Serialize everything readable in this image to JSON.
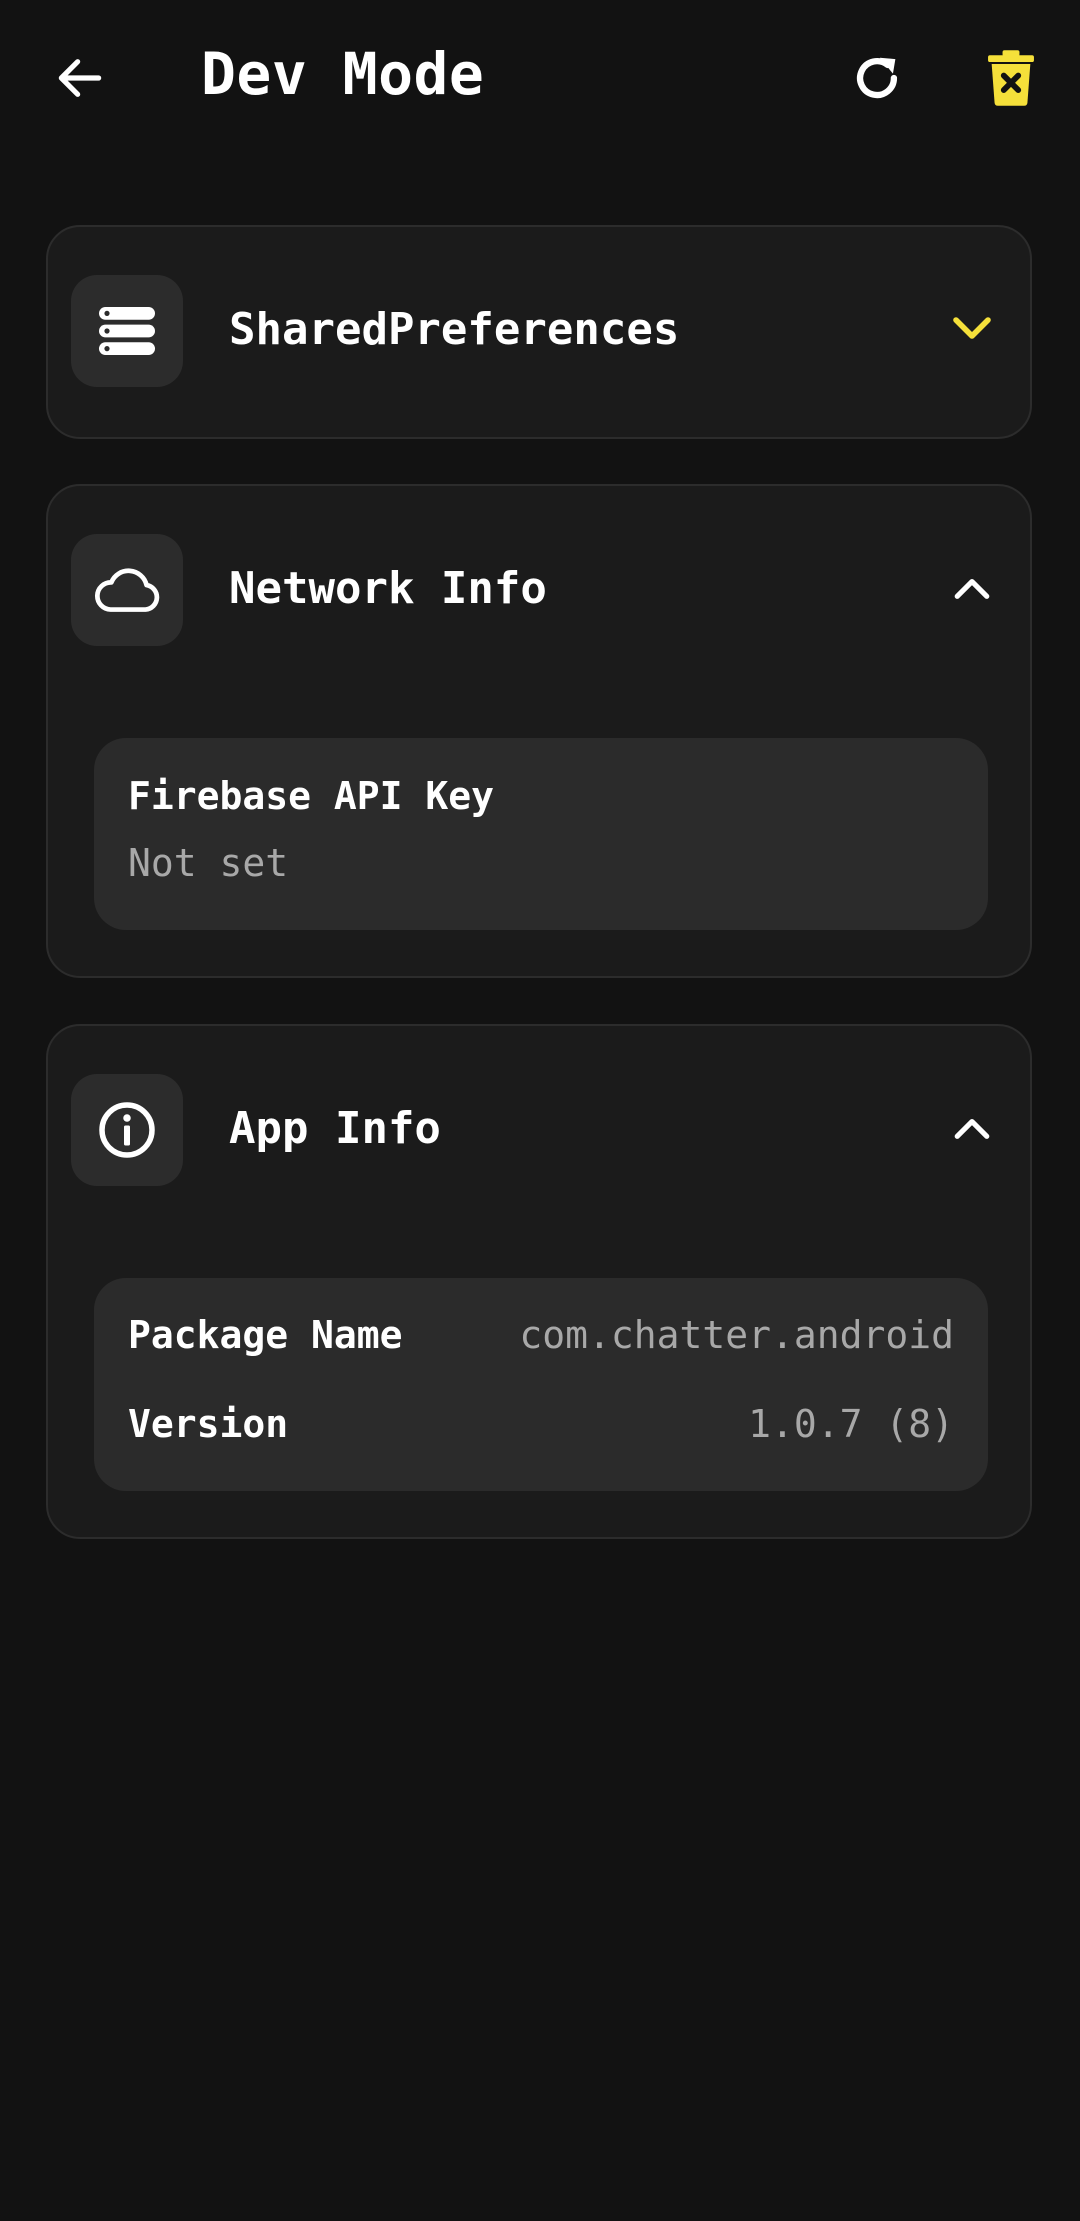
{
  "header": {
    "title": "Dev Mode",
    "icons": {
      "back": "arrow-left-icon",
      "refresh": "refresh-icon",
      "clear": "trash-x-icon"
    }
  },
  "colors": {
    "background": "#121212",
    "card": "#1b1b1b",
    "panel": "#2b2b2b",
    "accent": "#f5e03a",
    "muted_text": "#a8a8a8"
  },
  "sections": {
    "shared_prefs": {
      "title": "SharedPreferences",
      "icon": "storage-icon",
      "expanded": false
    },
    "network": {
      "title": "Network Info",
      "icon": "cloud-icon",
      "expanded": true,
      "items": [
        {
          "label": "Firebase API Key",
          "value": "Not set"
        }
      ]
    },
    "app": {
      "title": "App Info",
      "icon": "info-icon",
      "expanded": true,
      "items": [
        {
          "label": "Package Name",
          "value": "com.chatter.android"
        },
        {
          "label": "Version",
          "value": "1.0.7 (8)"
        }
      ]
    }
  }
}
